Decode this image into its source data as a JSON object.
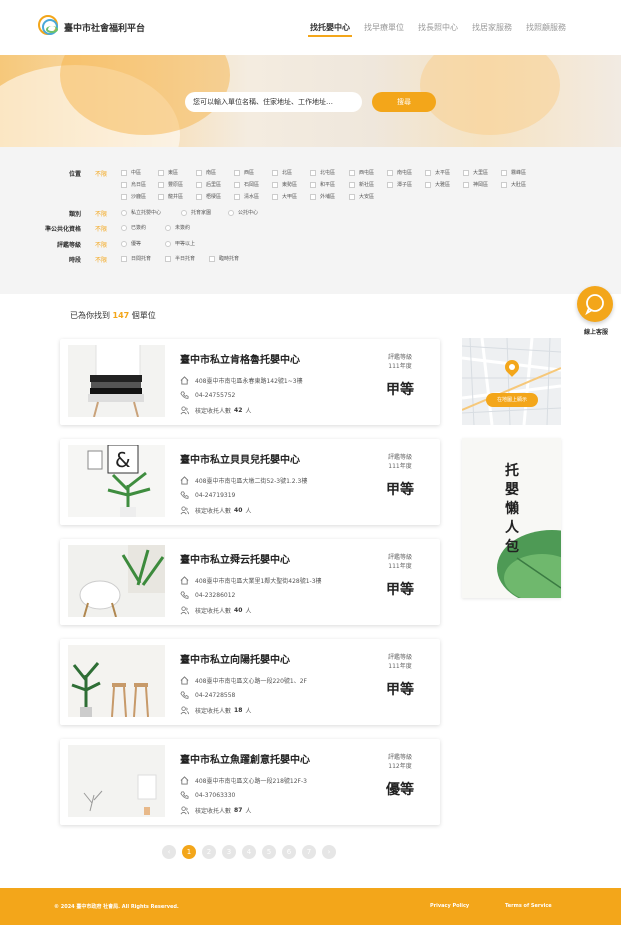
{
  "header": {
    "brand": "臺中市社會福利平台",
    "nav": [
      "找托嬰中心",
      "找早療單位",
      "找長照中心",
      "找居家服務",
      "找照顧服務"
    ],
    "active_nav": 0
  },
  "search": {
    "placeholder": "您可以輸入單位名稱、住家地址、工作地址…",
    "button": "搜尋"
  },
  "filters": {
    "location": {
      "label": "位置",
      "any": "不限",
      "options": [
        "中區",
        "東區",
        "南區",
        "西區",
        "北區",
        "北屯區",
        "西屯區",
        "南屯區",
        "太平區",
        "大里區",
        "霧峰區",
        "烏日區",
        "豐原區",
        "后里區",
        "石岡區",
        "東勢區",
        "和平區",
        "新社區",
        "潭子區",
        "大雅區",
        "神岡區",
        "大肚區",
        "沙鹿區",
        "龍井區",
        "梧棲區",
        "清水區",
        "大甲區",
        "外埔區",
        "大安區"
      ]
    },
    "category": {
      "label": "類別",
      "any": "不限",
      "options": [
        "私立托嬰中心",
        "托育家園",
        "公托中心"
      ]
    },
    "quasi_public": {
      "label": "準公共化資格",
      "any": "不限",
      "options": [
        "已簽約",
        "未簽約"
      ]
    },
    "rating": {
      "label": "評鑑等級",
      "any": "不限",
      "options": [
        "優等",
        "甲等以上"
      ]
    },
    "period": {
      "label": "時段",
      "any": "不限",
      "options": [
        "日間托育",
        "半日托育",
        "臨時托育"
      ]
    }
  },
  "results": {
    "prefix": "已為你找到",
    "count": "147",
    "suffix": "個單位",
    "eval_label": "評鑑等級",
    "capacity_label": "核定收托人數",
    "capacity_unit": "人",
    "items": [
      {
        "name": "臺中市私立肯格魯托嬰中心",
        "address": "408臺中市南屯區永春東路142號1~3樓",
        "phone": "04-24755752",
        "capacity": "42",
        "year": "111年度",
        "grade": "甲等"
      },
      {
        "name": "臺中市私立貝貝兒托嬰中心",
        "address": "408臺中市南屯區大墩二街52-3號1.2.3樓",
        "phone": "04-24719319",
        "capacity": "40",
        "year": "111年度",
        "grade": "甲等"
      },
      {
        "name": "臺中市私立舜云托嬰中心",
        "address": "408臺中市南屯區大業里1鄰大聖街428號1-3樓",
        "phone": "04-23286012",
        "capacity": "40",
        "year": "111年度",
        "grade": "甲等"
      },
      {
        "name": "臺中市私立向陽托嬰中心",
        "address": "408臺中市南屯區文心路一段220號1、2F",
        "phone": "04-24728558",
        "capacity": "18",
        "year": "111年度",
        "grade": "甲等"
      },
      {
        "name": "臺中市私立魚躍創意托嬰中心",
        "address": "408臺中市南屯區文心路一段218號12F-3",
        "phone": "04-37063330",
        "capacity": "87",
        "year": "112年度",
        "grade": "優等"
      }
    ]
  },
  "sidebar": {
    "map_button": "在地圖上顯示",
    "promo_text": "托嬰懶人包"
  },
  "chat": {
    "label": "線上客服"
  },
  "pagination": {
    "pages": [
      "1",
      "2",
      "3",
      "4",
      "5",
      "6",
      "7"
    ],
    "active": "1"
  },
  "footer": {
    "copyright": "© 2024 臺中市政府 社會局. All Rights Reserved.",
    "privacy": "Privacy Policy",
    "terms": "Terms of Service"
  },
  "colors": {
    "accent": "#f3a61a",
    "filter_bg": "#f4f4f4"
  }
}
